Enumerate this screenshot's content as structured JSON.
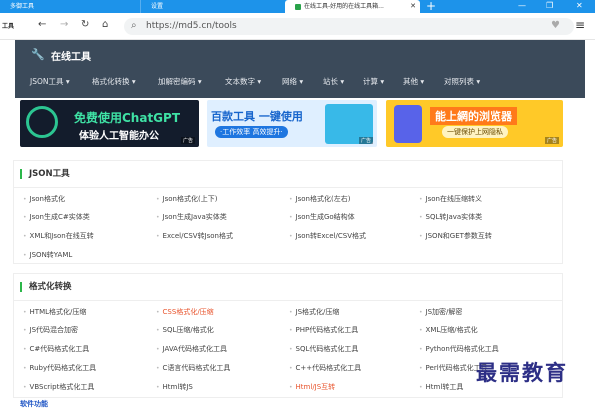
{
  "browser": {
    "tabs": [
      {
        "label": "多御工具"
      },
      {
        "label": "设置"
      },
      {
        "label": "在线工具-好用的在线工具箱..."
      }
    ],
    "new_tab": "+",
    "toolbar_label": "工具",
    "url": "https://md5.cn/tools",
    "menu_icon": "≡"
  },
  "header": {
    "title": "在线工具",
    "nav": [
      "JSON工具",
      "格式化转换",
      "加解密编码",
      "文本数字",
      "网络",
      "站长",
      "计算",
      "其他",
      "对照列表"
    ]
  },
  "banners": [
    {
      "line1": "免费使用ChatGPT",
      "line2": "体验人工智能办公",
      "ad": "广告"
    },
    {
      "line1": "百款工具 一键使用",
      "line2": "·工作效率 高效提升·",
      "ad": "广告"
    },
    {
      "line1": "能上網的浏览器",
      "line2": "一键保护上网隐私",
      "ad": "广告"
    }
  ],
  "sections": [
    {
      "title": "JSON工具",
      "items": [
        [
          "Json格式化",
          "Json格式化(上下)",
          "Json格式化(左右)",
          "Json在线压缩转义"
        ],
        [
          "Json生成C#实体类",
          "Json生成Java实体类",
          "Json生成Go结构体",
          "SQL转Java实体类"
        ],
        [
          "XML和Json在线互转",
          "Excel/CSV转Json格式",
          "Json转Excel/CSV格式",
          "JSON和GET参数互转"
        ],
        [
          "JSON转YAML"
        ]
      ]
    },
    {
      "title": "格式化转换",
      "items": [
        [
          "HTML格式化/压缩",
          "CSS格式化/压缩",
          "JS格式化/压缩",
          "JS加密/解密"
        ],
        [
          "JS代码混合加密",
          "SQL压缩/格式化",
          "PHP代码格式化工具",
          "XML压缩/格式化"
        ],
        [
          "C#代码格式化工具",
          "JAVA代码格式化工具",
          "SQL代码格式化工具",
          "Python代码格式化工具"
        ],
        [
          "Ruby代码格式化工具",
          "C语言代码格式化工具",
          "C++代码格式化工具",
          "Perl代码格式化工具"
        ],
        [
          "VBScript格式化工具",
          "Html转JS",
          "Html/JS互转",
          "Html转工具"
        ]
      ],
      "highlight": [
        "CSS格式化/压缩",
        "Html/JS互转"
      ]
    }
  ],
  "watermark": "最需教育",
  "bottom_partial": "软件功能",
  "colors": {
    "tabbar": "#1d93ea",
    "header": "#3b4a5a",
    "accent": "#2cb74a",
    "highlight": "#e8542d"
  }
}
